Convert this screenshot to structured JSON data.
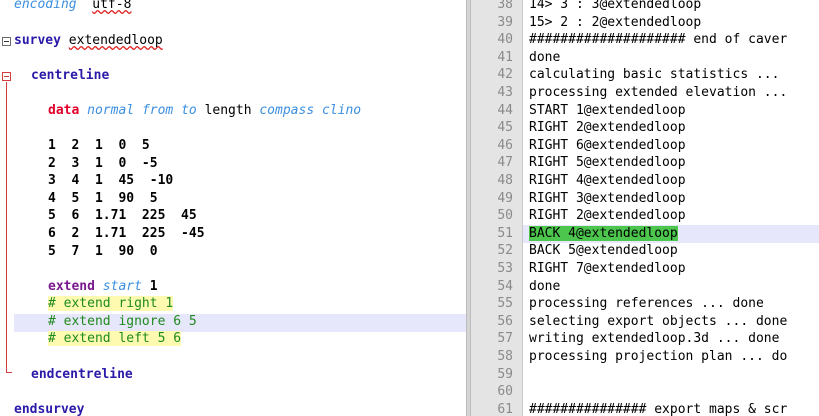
{
  "left_editor": {
    "line1_kw": "encoding",
    "line1_val": "utf-8",
    "survey_kw": "survey",
    "survey_name": "extendedloop",
    "centreline_kw": "centreline",
    "data_kw": "data",
    "data_style": "normal",
    "data_from": "from",
    "data_to": "to",
    "data_length": "length",
    "data_compass": "compass",
    "data_clino": "clino",
    "rows": [
      "1  2  1  0  5",
      "2  3  1  0  -5",
      "3  4  1  45  -10",
      "4  5  1  90  5",
      "5  6  1.71  225  45",
      "6  2  1.71  225  -45",
      "5  7  1  90  0"
    ],
    "extend_kw": "extend",
    "extend_start": "start",
    "extend_val": "1",
    "comments": [
      "# extend right 1",
      "# extend ignore 6 5",
      "# extend left 5 6"
    ],
    "endcentreline_kw": "endcentreline",
    "endsurvey_kw": "endsurvey"
  },
  "right_log": {
    "lines": [
      {
        "n": "38",
        "t": "14> 3 : 3@extendedloop"
      },
      {
        "n": "39",
        "t": "15> 2 : 2@extendedloop"
      },
      {
        "n": "40",
        "t": "#################### end of caver"
      },
      {
        "n": "41",
        "t": "done"
      },
      {
        "n": "42",
        "t": "calculating basic statistics ..."
      },
      {
        "n": "43",
        "t": "processing extended elevation ..."
      },
      {
        "n": "44",
        "t": "START 1@extendedloop"
      },
      {
        "n": "45",
        "t": "RIGHT 2@extendedloop"
      },
      {
        "n": "46",
        "t": "RIGHT 6@extendedloop"
      },
      {
        "n": "47",
        "t": "RIGHT 5@extendedloop"
      },
      {
        "n": "48",
        "t": "RIGHT 4@extendedloop"
      },
      {
        "n": "49",
        "t": "RIGHT 3@extendedloop"
      },
      {
        "n": "50",
        "t": "RIGHT 2@extendedloop"
      },
      {
        "n": "51",
        "t": "BACK 4@extendedloop"
      },
      {
        "n": "52",
        "t": "BACK 5@extendedloop"
      },
      {
        "n": "53",
        "t": "RIGHT 7@extendedloop"
      },
      {
        "n": "54",
        "t": "done"
      },
      {
        "n": "55",
        "t": "processing references ... done"
      },
      {
        "n": "56",
        "t": "selecting export objects ... done"
      },
      {
        "n": "57",
        "t": "writing extendedloop.3d ... done"
      },
      {
        "n": "58",
        "t": "processing projection plan ... do"
      },
      {
        "n": "59",
        "t": ""
      },
      {
        "n": "60",
        "t": ""
      },
      {
        "n": "61",
        "t": "############### export maps & scr"
      }
    ]
  }
}
